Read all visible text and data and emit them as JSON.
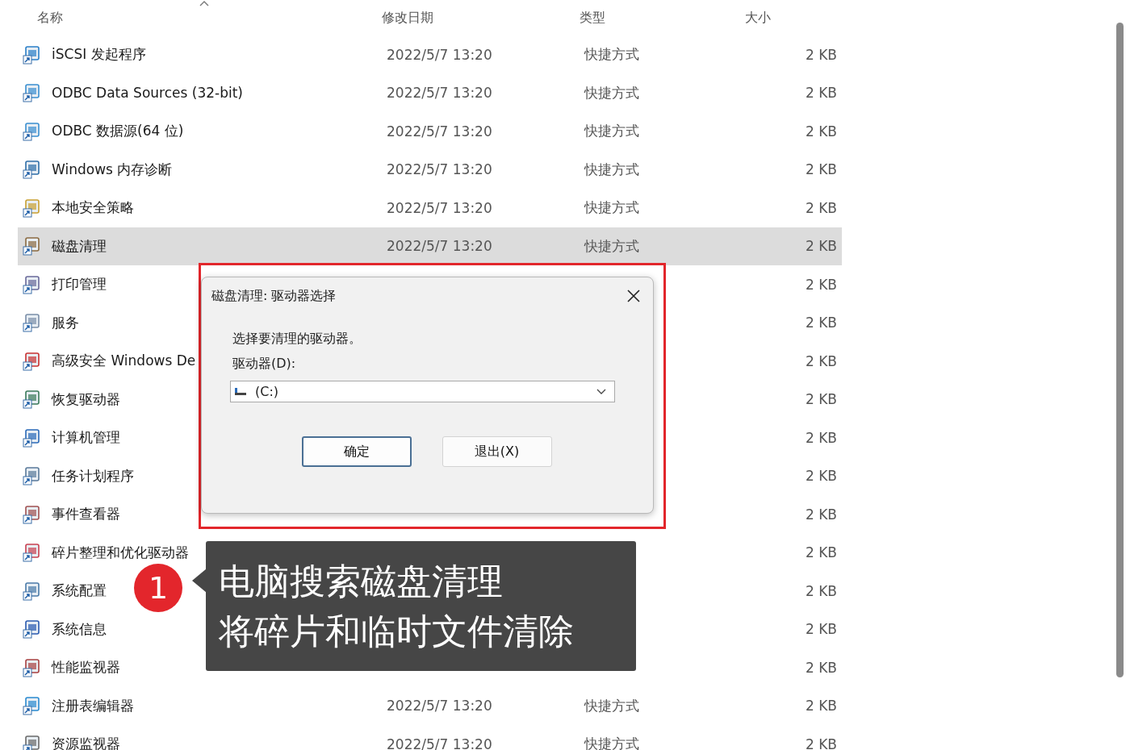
{
  "columns": [
    {
      "label": "名称",
      "sorted": true
    },
    {
      "label": "修改日期",
      "sorted": false
    },
    {
      "label": "类型",
      "sorted": false
    },
    {
      "label": "大小",
      "sorted": false
    }
  ],
  "files": [
    {
      "name": "iSCSI 发起程序",
      "date": "2022/5/7 13:20",
      "type": "快捷方式",
      "size": "2 KB",
      "selected": false
    },
    {
      "name": "ODBC Data Sources (32-bit)",
      "date": "2022/5/7 13:20",
      "type": "快捷方式",
      "size": "2 KB",
      "selected": false
    },
    {
      "name": "ODBC 数据源(64 位)",
      "date": "2022/5/7 13:20",
      "type": "快捷方式",
      "size": "2 KB",
      "selected": false
    },
    {
      "name": "Windows 内存诊断",
      "date": "2022/5/7 13:20",
      "type": "快捷方式",
      "size": "2 KB",
      "selected": false
    },
    {
      "name": "本地安全策略",
      "date": "2022/5/7 13:20",
      "type": "快捷方式",
      "size": "2 KB",
      "selected": false
    },
    {
      "name": "磁盘清理",
      "date": "2022/5/7 13:20",
      "type": "快捷方式",
      "size": "2 KB",
      "selected": true
    },
    {
      "name": "打印管理",
      "size": "2 KB",
      "selected": false
    },
    {
      "name": "服务",
      "size": "2 KB",
      "selected": false
    },
    {
      "name": "高级安全 Windows De",
      "size": "2 KB",
      "selected": false
    },
    {
      "name": "恢复驱动器",
      "size": "2 KB",
      "selected": false
    },
    {
      "name": "计算机管理",
      "size": "2 KB",
      "selected": false
    },
    {
      "name": "任务计划程序",
      "size": "2 KB",
      "selected": false
    },
    {
      "name": "事件查看器",
      "size": "2 KB",
      "selected": false
    },
    {
      "name": "碎片整理和优化驱动器",
      "size": "2 KB",
      "selected": false
    },
    {
      "name": "系统配置",
      "size": "2 KB",
      "selected": false
    },
    {
      "name": "系统信息",
      "size": "2 KB",
      "selected": false
    },
    {
      "name": "性能监视器",
      "size": "2 KB",
      "selected": false
    },
    {
      "name": "注册表编辑器",
      "date": "2022/5/7 13:20",
      "type": "快捷方式",
      "size": "2 KB",
      "selected": false
    },
    {
      "name": "资源监视器",
      "date": "2022/5/7 13:20",
      "type": "快捷方式",
      "size": "2 KB",
      "selected": false
    }
  ],
  "dialog": {
    "title": "磁盘清理: 驱动器选择",
    "prompt": "选择要清理的驱动器。",
    "drive_label": "驱动器(D):",
    "drive_value": "(C:)",
    "buttons": [
      {
        "label": "确定",
        "default": true
      },
      {
        "label": "退出(X)",
        "default": false
      }
    ]
  },
  "callout": {
    "badge": "1",
    "lines": [
      "电脑搜索磁盘清理",
      "将碎片和临时文件清除"
    ]
  }
}
